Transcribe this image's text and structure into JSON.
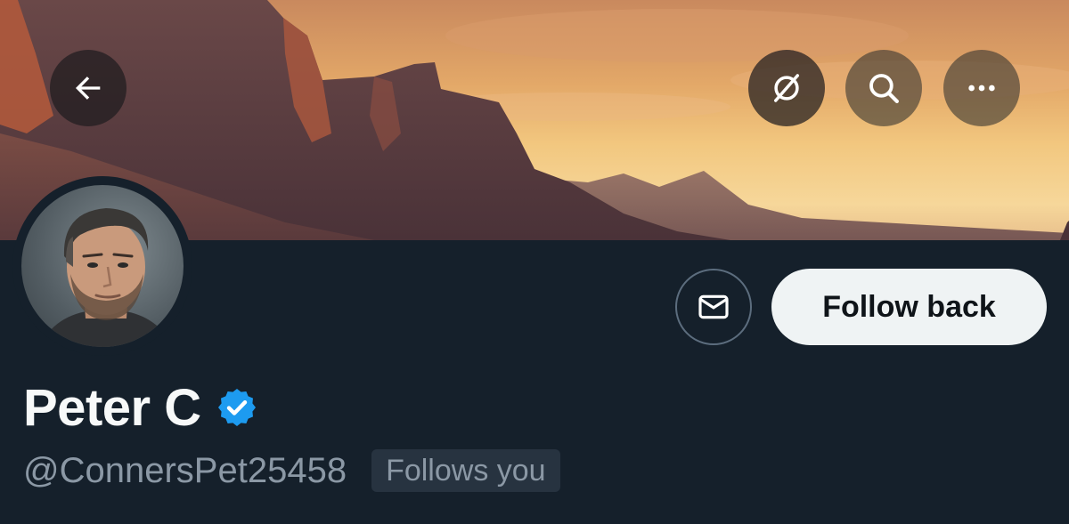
{
  "header": {
    "back_icon": "arrow-left-icon",
    "grok_icon": "grok-icon",
    "search_icon": "search-icon",
    "more_icon": "more-horizontal-icon"
  },
  "profile": {
    "display_name": "Peter C",
    "handle": "@ConnersPet25458",
    "follows_you_label": "Follows you",
    "verified_icon": "verified-badge-icon",
    "message_icon": "envelope-icon",
    "follow_back_label": "Follow back"
  },
  "colors": {
    "background": "#15202b",
    "primary_text": "#f7f9f9",
    "secondary_text": "#8b98a5",
    "verified_blue": "#1d9bf0",
    "follow_button_bg": "#eff3f4",
    "badge_bg": "#273340"
  }
}
